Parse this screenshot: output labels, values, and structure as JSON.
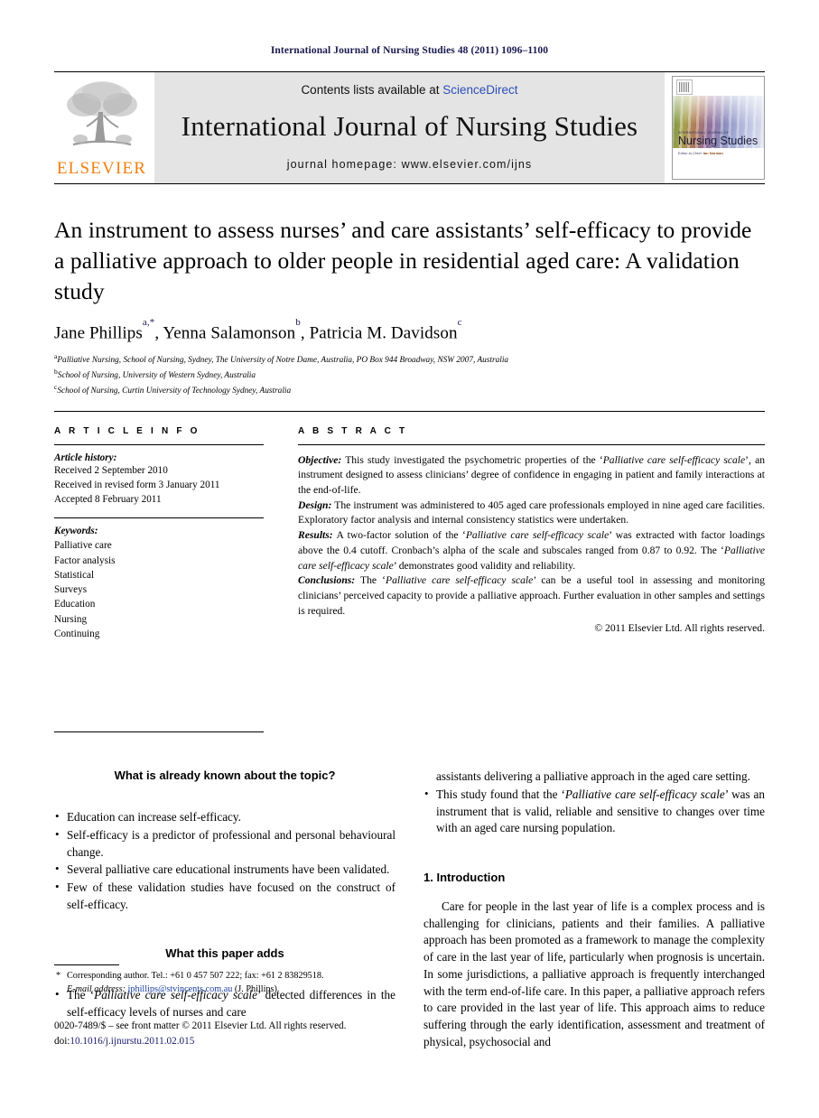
{
  "running_head": "International Journal of Nursing Studies 48 (2011) 1096–1100",
  "masthead": {
    "contents_prefix": "Contents lists available at ",
    "sciencedirect": "ScienceDirect",
    "journal_name": "International Journal of Nursing Studies",
    "homepage": "journal homepage: www.elsevier.com/ijns",
    "publisher_wordmark": "ELSEVIER",
    "cover": {
      "kicker": "INTERNATIONAL JOURNAL OF",
      "title": "Nursing Studies",
      "sub_prefix": "Editor-in-Chief: ",
      "sub_name": "Ian Norman"
    },
    "accent_link_color": "#2a4fbb",
    "elsevier_orange": "#f08010"
  },
  "article": {
    "title": "An instrument to assess nurses’ and care assistants’ self-efficacy to provide a palliative approach to older people in residential aged care: A validation study",
    "authors": [
      {
        "name": "Jane Phillips",
        "sup": "a,*"
      },
      {
        "name": "Yenna Salamonson",
        "sup": "b"
      },
      {
        "name": "Patricia M. Davidson",
        "sup": "c"
      }
    ],
    "affiliations": [
      {
        "sup": "a",
        "text": "Palliative Nursing, School of Nursing, Sydney, The University of Notre Dame, Australia, PO Box 944 Broadway, NSW 2007, Australia"
      },
      {
        "sup": "b",
        "text": "School of Nursing, University of Western Sydney, Australia"
      },
      {
        "sup": "c",
        "text": "School of Nursing, Curtin University of Technology Sydney, Australia"
      }
    ]
  },
  "article_info": {
    "heading": "A R T I C L E   I N F O",
    "history_label": "Article history:",
    "history": [
      "Received 2 September 2010",
      "Received in revised form 3 January 2011",
      "Accepted 8 February 2011"
    ],
    "keywords_label": "Keywords:",
    "keywords": [
      "Palliative care",
      "Factor analysis",
      "Statistical",
      "Surveys",
      "Education",
      "Nursing",
      "Continuing"
    ]
  },
  "abstract": {
    "heading": "A B S T R A C T",
    "sections": [
      {
        "label": "Objective:",
        "text_parts": [
          {
            "t": "This study investigated the psychometric properties of the ‘",
            "i": false
          },
          {
            "t": "Palliative care self-efficacy scale",
            "i": true
          },
          {
            "t": "’, an instrument designed to assess clinicians’ degree of confidence in engaging in patient and family interactions at the end-of-life.",
            "i": false
          }
        ]
      },
      {
        "label": "Design:",
        "text_parts": [
          {
            "t": "The instrument was administered to 405 aged care professionals employed in nine aged care facilities. Exploratory factor analysis and internal consistency statistics were undertaken.",
            "i": false
          }
        ]
      },
      {
        "label": "Results:",
        "text_parts": [
          {
            "t": "A two-factor solution of the ‘",
            "i": false
          },
          {
            "t": "Palliative care self-efficacy scale",
            "i": true
          },
          {
            "t": "’ was extracted with factor loadings above the 0.4 cutoff. Cronbach’s alpha of the scale and subscales ranged from 0.87 to 0.92. The ‘",
            "i": false
          },
          {
            "t": "Palliative care self-efficacy scale",
            "i": true
          },
          {
            "t": "’ demonstrates good validity and reliability.",
            "i": false
          }
        ]
      },
      {
        "label": "Conclusions:",
        "text_parts": [
          {
            "t": "The ‘",
            "i": false
          },
          {
            "t": "Palliative care self-efficacy scale",
            "i": true
          },
          {
            "t": "’ can be a useful tool in assessing and monitoring clinicians’ perceived capacity to provide a palliative approach. Further evaluation in other samples and settings is required.",
            "i": false
          }
        ]
      }
    ],
    "copyright": "© 2011 Elsevier Ltd. All rights reserved."
  },
  "highlight_boxes": {
    "known": {
      "heading": "What is already known about the topic?",
      "bullets": [
        [
          {
            "t": "Education can increase self-efficacy.",
            "i": false
          }
        ],
        [
          {
            "t": "Self-efficacy is a predictor of professional and personal behavioural change.",
            "i": false
          }
        ],
        [
          {
            "t": "Several palliative care educational instruments have been validated.",
            "i": false
          }
        ],
        [
          {
            "t": "Few of these validation studies have focused on the construct of self-efficacy.",
            "i": false
          }
        ]
      ]
    },
    "adds": {
      "heading": "What this paper adds",
      "bullets": [
        [
          {
            "t": "The ‘",
            "i": false
          },
          {
            "t": "Palliative care self-efficacy scale",
            "i": true
          },
          {
            "t": "’ detected differences in the self-efficacy levels of nurses and care assistants delivering a palliative approach in the aged care setting.",
            "i": false
          }
        ],
        [
          {
            "t": "This study found that the ‘",
            "i": false
          },
          {
            "t": "Palliative care self-efficacy scale",
            "i": true
          },
          {
            "t": "’ was an instrument that is valid, reliable and sensitive to changes over time with an aged care nursing population.",
            "i": false
          }
        ]
      ]
    }
  },
  "introduction": {
    "heading": "1. Introduction",
    "paragraph": "Care for people in the last year of life is a complex process and is challenging for clinicians, patients and their families. A palliative approach has been promoted as a framework to manage the complexity of care in the last year of life, particularly when prognosis is uncertain. In some jurisdictions, a palliative approach is frequently interchanged with the term end-of-life care. In this paper, a palliative approach refers to care provided in the last year of life. This approach aims to reduce suffering through the early identification, assessment and treatment of physical, psychosocial and"
  },
  "footnote": {
    "star": "*",
    "corresponding": "Corresponding author. Tel.: +61 0 457 507 222; fax: +61 2 83829518.",
    "email_label": "E-mail address:",
    "email": "jphillips@stvincents.com.au",
    "email_suffix": "(J. Phillips)."
  },
  "footer": {
    "line1": "0020-7489/$ – see front matter © 2011 Elsevier Ltd. All rights reserved.",
    "doi_label": "doi:",
    "doi": "10.1016/j.ijnurstu.2011.02.015"
  }
}
